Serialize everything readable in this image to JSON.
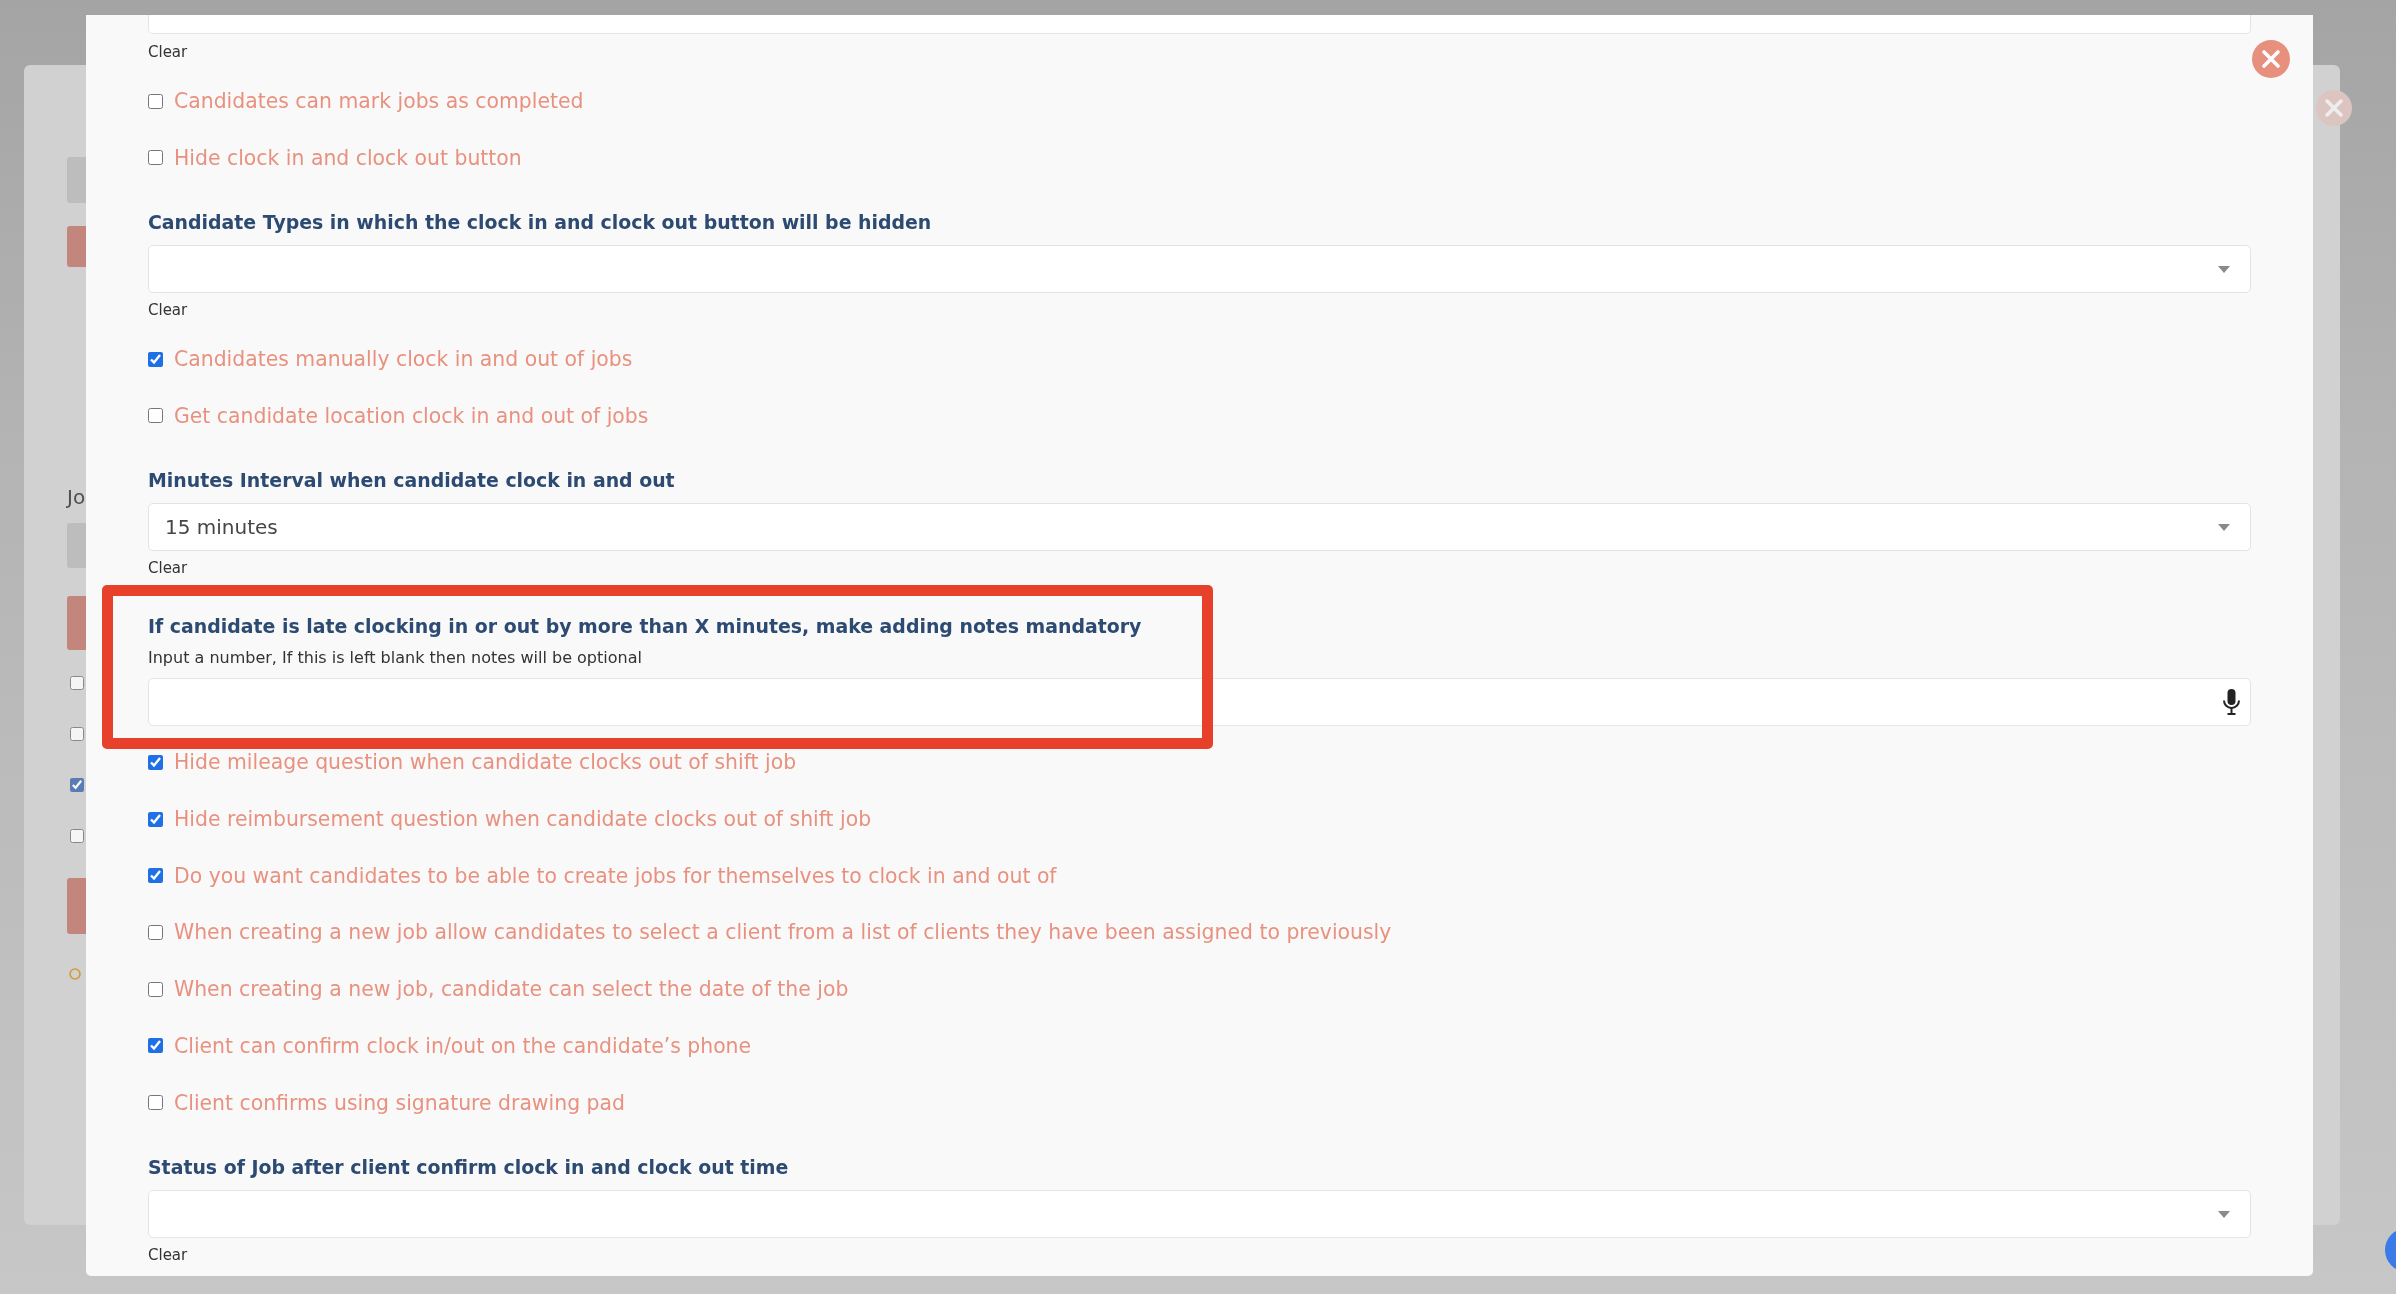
{
  "background": {
    "heading": "Jo",
    "checkboxes": [
      {
        "checked": false
      },
      {
        "checked": false
      },
      {
        "checked": true
      },
      {
        "checked": false
      }
    ]
  },
  "modal": {
    "top_field": {
      "clear": "Clear"
    },
    "items": [
      {
        "kind": "checkbox",
        "label": "Candidates can mark jobs as completed",
        "checked": false
      },
      {
        "kind": "checkbox",
        "label": "Hide clock in and clock out button",
        "checked": false
      },
      {
        "kind": "select",
        "label": "Candidate Types in which the clock in and clock out button will be hidden",
        "clear": "Clear"
      },
      {
        "kind": "checkbox",
        "label": "Candidates manually clock in and out of jobs",
        "checked": true
      },
      {
        "kind": "checkbox",
        "label": "Get candidate location clock in and out of jobs",
        "checked": false
      },
      {
        "kind": "select",
        "label": "Minutes Interval when candidate clock in and out",
        "value": "15 minutes",
        "clear": "Clear"
      },
      {
        "kind": "number",
        "label": "If candidate is late clocking in or out by more than X minutes, make adding notes mandatory",
        "hint": "Input a number, If this is left blank then notes will be optional",
        "highlighted": true
      },
      {
        "kind": "checkbox",
        "label": "Hide mileage question when candidate clocks out of shift job",
        "checked": true
      },
      {
        "kind": "checkbox",
        "label": "Hide reimbursement question when candidate clocks out of shift job",
        "checked": true
      },
      {
        "kind": "checkbox",
        "label": "Do you want candidates to be able to create jobs for themselves to clock in and out of",
        "checked": true
      },
      {
        "kind": "checkbox",
        "label": "When creating a new job allow candidates to select a client from a list of clients they have been assigned to previously",
        "checked": false
      },
      {
        "kind": "checkbox",
        "label": "When creating a new job, candidate can select the date of the job",
        "checked": false
      },
      {
        "kind": "checkbox",
        "label": "Client can confirm clock in/out on the candidate’s phone",
        "checked": true
      },
      {
        "kind": "checkbox",
        "label": "Client confirms using signature drawing pad",
        "checked": false
      },
      {
        "kind": "select",
        "label": "Status of Job after client confirm clock in and clock out time",
        "clear": "Clear"
      }
    ]
  }
}
